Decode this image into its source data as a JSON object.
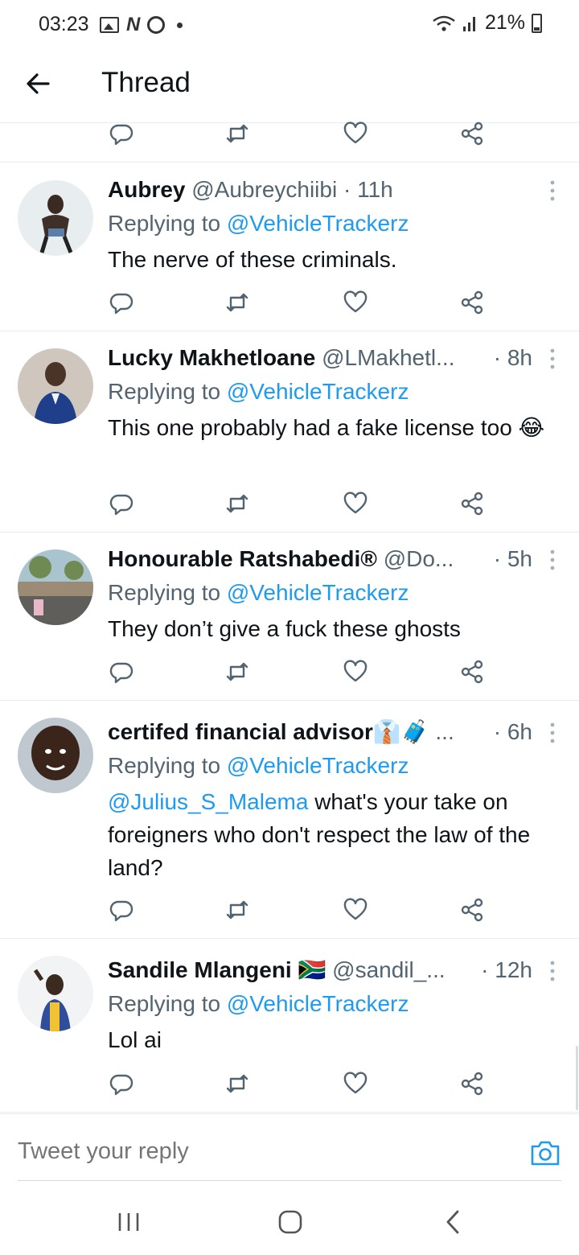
{
  "status_bar": {
    "time": "03:23",
    "battery": "21%",
    "notification_icons": [
      "gallery-icon",
      "n-icon",
      "chrome-icon",
      "dot-icon"
    ]
  },
  "header": {
    "title": "Thread"
  },
  "tweets": [
    {
      "name": "Aubrey",
      "handle": "@Aubreychiibi · 11h",
      "time": "",
      "replying_prefix": "Replying to ",
      "replying_to": "@VehicleTrackerz",
      "text_mention": "",
      "text": "The nerve of these criminals."
    },
    {
      "name": "Lucky Makhetloane",
      "handle": "@LMakhetl...",
      "time": "· 8h",
      "replying_prefix": "Replying to ",
      "replying_to": "@VehicleTrackerz",
      "text_mention": "",
      "text": "This one probably had a fake license too 😂"
    },
    {
      "name": "Honourable Ratshabedi®",
      "handle": "@Do...",
      "time": "· 5h",
      "replying_prefix": "Replying to ",
      "replying_to": "@VehicleTrackerz",
      "text_mention": "",
      "text": "They don’t give a fuck these ghosts"
    },
    {
      "name": "certifed financial advisor👔🧳",
      "handle": "...",
      "time": "· 6h",
      "replying_prefix": "Replying to ",
      "replying_to": "@VehicleTrackerz",
      "text_mention": "@Julius_S_Malema",
      "text": " what's your take on foreigners who don't respect the law of the land?"
    },
    {
      "name": "Sandile Mlangeni 🇿🇦",
      "handle": "@sandil_...",
      "time": "· 12h",
      "replying_prefix": "Replying to ",
      "replying_to": "@VehicleTrackerz",
      "text_mention": "",
      "text": "Lol ai"
    }
  ],
  "actions": [
    "reply-icon",
    "retweet-icon",
    "like-icon",
    "share-icon"
  ],
  "reply_bar": {
    "placeholder": "Tweet your reply"
  },
  "colors": {
    "accent": "#1d9bf0",
    "text": "#0f1419",
    "secondary": "#536471",
    "divider": "#e6ecf0"
  }
}
